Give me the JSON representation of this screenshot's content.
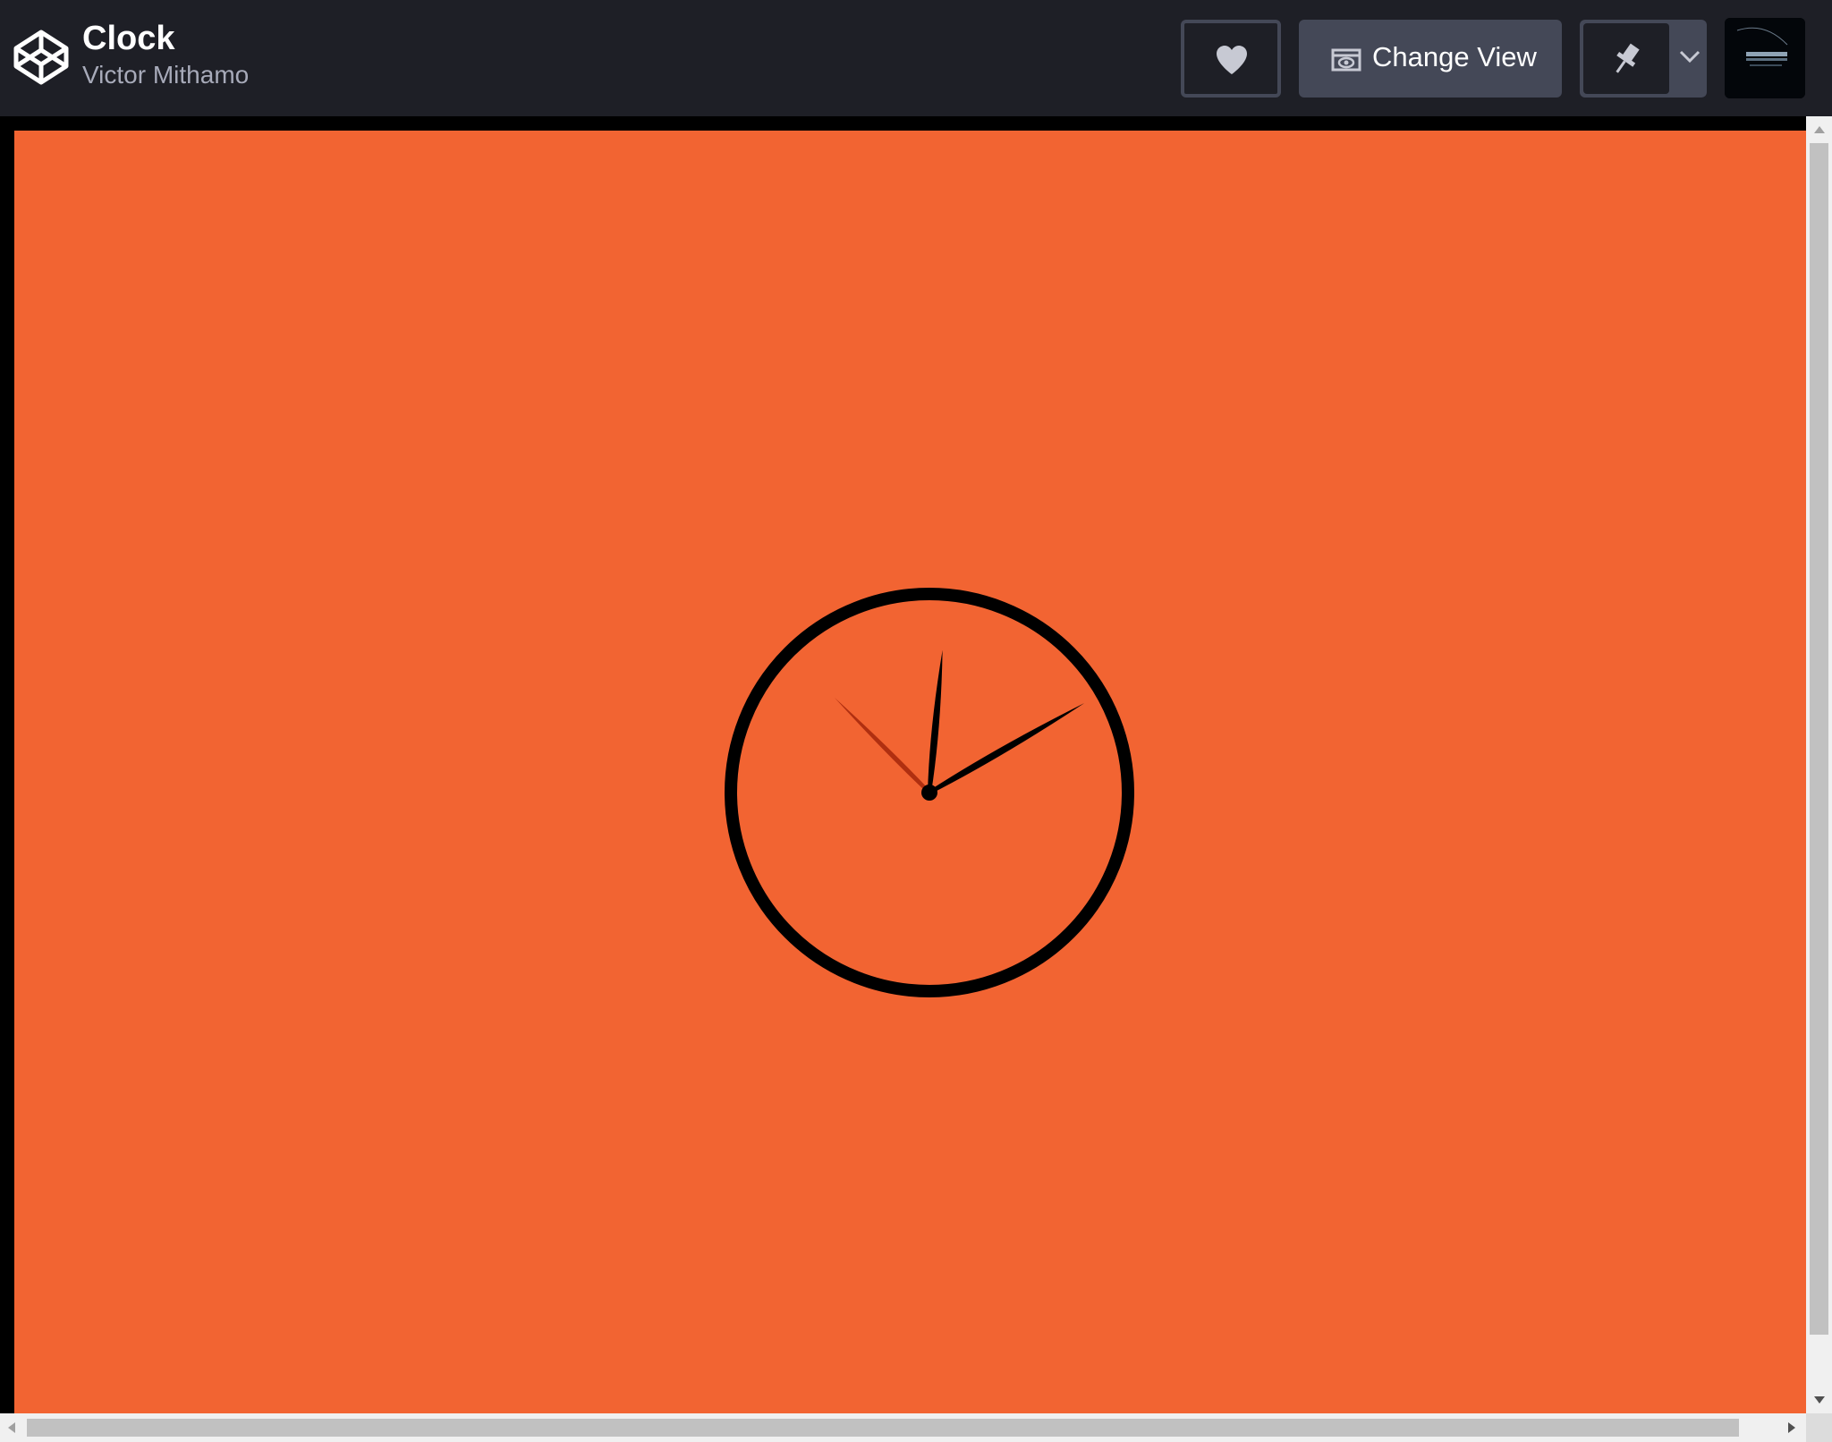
{
  "header": {
    "title": "Clock",
    "author": "Victor Mithamo",
    "logo_icon": "codepen-cube-icon",
    "heart_icon": "heart-icon",
    "change_view_label": "Change View",
    "change_view_icon": "eye-window-icon",
    "pin_icon": "pin-icon",
    "dropdown_icon": "chevron-down-icon",
    "avatar_icon": "user-avatar-image"
  },
  "preview": {
    "background_color": "#f26432",
    "clock": {
      "face_color": "#000000",
      "hour_hand_color": "#000000",
      "minute_hand_color": "#000000",
      "second_hand_color": "#b02f10",
      "hour": 2,
      "minute": 0,
      "second": 52.5
    }
  },
  "colors": {
    "header_bg": "#1e1f26",
    "button_bg": "#444857",
    "text_primary": "#ffffff",
    "text_secondary": "#a7aab9"
  }
}
